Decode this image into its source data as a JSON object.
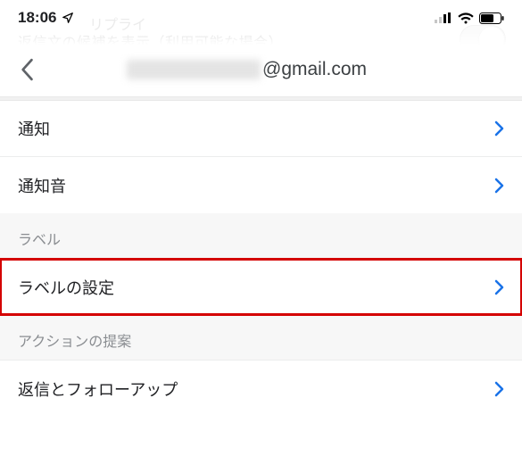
{
  "status": {
    "time": "18:06"
  },
  "ghost": {
    "line1": "リプライ",
    "line2": "返信文の候補を表示（利用可能な場合）"
  },
  "header": {
    "email_domain": "@gmail.com"
  },
  "rows": {
    "notifications": "通知",
    "sound": "通知音"
  },
  "sections": {
    "label_header": "ラベル",
    "label_settings": "ラベルの設定",
    "action_header": "アクションの提案",
    "reply_follow": "返信とフォローアップ"
  }
}
